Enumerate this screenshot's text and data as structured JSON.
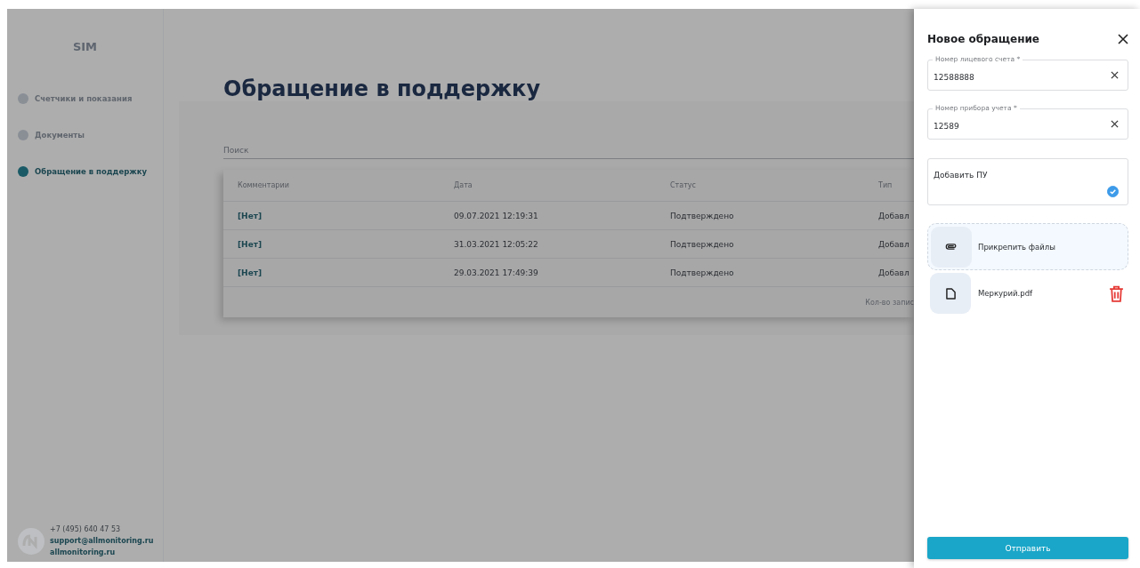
{
  "sidebar": {
    "logo": "SIM",
    "items": [
      {
        "label": "Счетчики и показания",
        "selected": false
      },
      {
        "label": "Документы",
        "selected": false
      },
      {
        "label": "Обращение в поддержку",
        "selected": true
      }
    ],
    "contacts": {
      "phone": "+7 (495) 640 47 53",
      "email": "support@allmonitoring.ru",
      "site": "allmonitoring.ru"
    }
  },
  "page": {
    "title": "Обращение в поддержку",
    "search": {
      "placeholder": "Поиск"
    },
    "table": {
      "columns": [
        "Комментарии",
        "Дата",
        "Статус",
        "Тип"
      ],
      "rows": [
        {
          "cells": [
            "[Нет]",
            "09.07.2021 12:19:31",
            "Подтверждено",
            "Добавл"
          ]
        },
        {
          "cells": [
            "[Нет]",
            "31.03.2021 12:05:22",
            "Подтверждено",
            "Добавл"
          ]
        },
        {
          "cells": [
            "[Нет]",
            "29.03.2021 17:49:39",
            "Подтверждено",
            "Добавл"
          ]
        }
      ],
      "footer": "Кол-во запис"
    }
  },
  "drawer": {
    "title": "Новое обращение",
    "fields": [
      {
        "kind": "input",
        "label": "Номер лицевого счета *",
        "value": "12588888"
      },
      {
        "kind": "input",
        "label": "Номер прибора учета *",
        "value": "12589"
      },
      {
        "kind": "check",
        "label": "Добавить ПУ",
        "checked": true
      }
    ],
    "attach": {
      "label": "Прикрепить файлы"
    },
    "files": [
      {
        "name": "Меркурий.pdf"
      }
    ],
    "submit": "Отправить"
  }
}
